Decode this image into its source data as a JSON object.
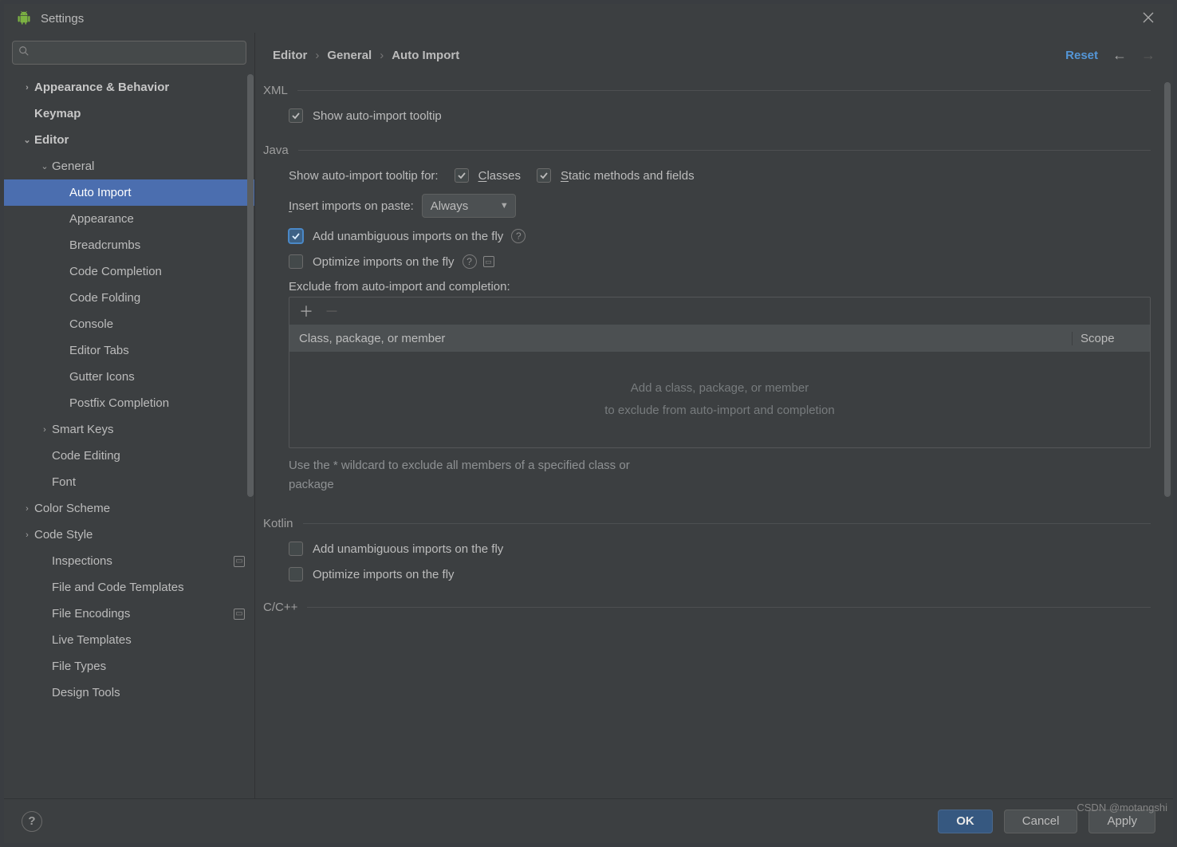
{
  "window": {
    "title": "Settings"
  },
  "search": {
    "placeholder": ""
  },
  "sidebar": {
    "items": [
      {
        "label": "Appearance & Behavior",
        "depth": 0,
        "arrow": "right",
        "bold": true
      },
      {
        "label": "Keymap",
        "depth": 0,
        "arrow": "",
        "bold": true
      },
      {
        "label": "Editor",
        "depth": 0,
        "arrow": "down",
        "bold": true
      },
      {
        "label": "General",
        "depth": 1,
        "arrow": "down",
        "bold": false
      },
      {
        "label": "Auto Import",
        "depth": 2,
        "arrow": "",
        "bold": false,
        "selected": true
      },
      {
        "label": "Appearance",
        "depth": 2,
        "arrow": "",
        "bold": false
      },
      {
        "label": "Breadcrumbs",
        "depth": 2,
        "arrow": "",
        "bold": false
      },
      {
        "label": "Code Completion",
        "depth": 2,
        "arrow": "",
        "bold": false
      },
      {
        "label": "Code Folding",
        "depth": 2,
        "arrow": "",
        "bold": false
      },
      {
        "label": "Console",
        "depth": 2,
        "arrow": "",
        "bold": false
      },
      {
        "label": "Editor Tabs",
        "depth": 2,
        "arrow": "",
        "bold": false
      },
      {
        "label": "Gutter Icons",
        "depth": 2,
        "arrow": "",
        "bold": false
      },
      {
        "label": "Postfix Completion",
        "depth": 2,
        "arrow": "",
        "bold": false
      },
      {
        "label": "Smart Keys",
        "depth": 1,
        "arrow": "right",
        "bold": false
      },
      {
        "label": "Code Editing",
        "depth": 1,
        "arrow": "",
        "bold": false
      },
      {
        "label": "Font",
        "depth": 1,
        "arrow": "",
        "bold": false
      },
      {
        "label": "Color Scheme",
        "depth": 0,
        "arrow": "right",
        "bold": false
      },
      {
        "label": "Code Style",
        "depth": 0,
        "arrow": "right",
        "bold": false
      },
      {
        "label": "Inspections",
        "depth": 1,
        "arrow": "",
        "bold": false,
        "badge": true
      },
      {
        "label": "File and Code Templates",
        "depth": 1,
        "arrow": "",
        "bold": false
      },
      {
        "label": "File Encodings",
        "depth": 1,
        "arrow": "",
        "bold": false,
        "badge": true
      },
      {
        "label": "Live Templates",
        "depth": 1,
        "arrow": "",
        "bold": false
      },
      {
        "label": "File Types",
        "depth": 1,
        "arrow": "",
        "bold": false
      },
      {
        "label": "Design Tools",
        "depth": 1,
        "arrow": "",
        "bold": false
      }
    ]
  },
  "breadcrumbs": {
    "a": "Editor",
    "b": "General",
    "c": "Auto Import",
    "reset": "Reset"
  },
  "sections": {
    "xml": {
      "title": "XML",
      "show_tooltip_label": "Show auto-import tooltip",
      "show_tooltip_checked": true
    },
    "java": {
      "title": "Java",
      "tooltip_for_label": "Show auto-import tooltip for:",
      "classes_label": "Classes",
      "classes_checked": true,
      "static_label": "Static methods and fields",
      "static_checked": true,
      "insert_label": "Insert imports on paste:",
      "insert_value": "Always",
      "unamb_label": "Add unambiguous imports on the fly",
      "unamb_checked": true,
      "opt_label": "Optimize imports on the fly",
      "opt_checked": false,
      "exclude_label": "Exclude from auto-import and completion:",
      "exclude_col1": "Class, package, or member",
      "exclude_col2": "Scope",
      "exclude_empty1": "Add a class, package, or member",
      "exclude_empty2": "to exclude from auto-import and completion",
      "hint1": "Use the * wildcard to exclude all members of a specified class or",
      "hint2": "package"
    },
    "kotlin": {
      "title": "Kotlin",
      "unamb_label": "Add unambiguous imports on the fly",
      "unamb_checked": false,
      "opt_label": "Optimize imports on the fly",
      "opt_checked": false
    },
    "ccpp": {
      "title": "C/C++"
    }
  },
  "footer": {
    "ok": "OK",
    "cancel": "Cancel",
    "apply": "Apply"
  },
  "watermark": "CSDN @motangshi"
}
